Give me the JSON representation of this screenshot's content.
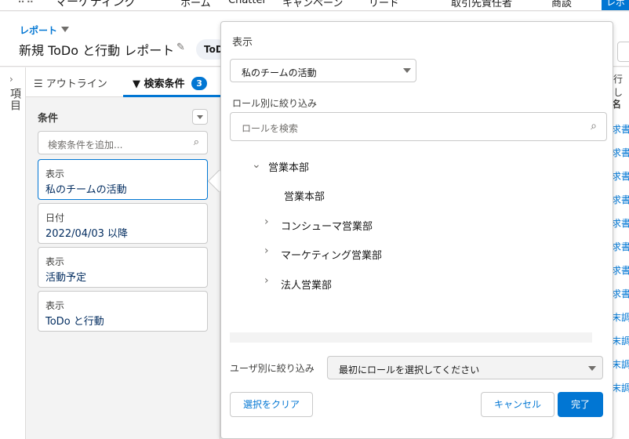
{
  "nav": {
    "app_name": "マーケティング",
    "items": [
      "ホーム",
      "Chatter",
      "キャンペーン",
      "リード",
      "取引先責任者",
      "商談"
    ],
    "active_item": "レポ"
  },
  "header": {
    "breadcrumb": "レポート",
    "title": "新規 ToDo と行動 レポート",
    "pill": "ToD"
  },
  "leftbar": {
    "label": "項目"
  },
  "tabs": {
    "outline": "アウトライン",
    "filters": "検索条件",
    "filters_count": "3"
  },
  "filters": {
    "heading": "条件",
    "search_placeholder": "検索条件を追加...",
    "cards": [
      {
        "key": "表示",
        "value": "私のチームの活動"
      },
      {
        "key": "日付",
        "value": "2022/04/03 以降"
      },
      {
        "key": "表示",
        "value": "活動予定"
      },
      {
        "key": "表示",
        "value": "ToDo と行動"
      }
    ]
  },
  "popover": {
    "show_label": "表示",
    "show_value": "私のチームの活動",
    "role_filter_label": "ロール別に絞り込み",
    "role_search_placeholder": "ロールを検索",
    "tree": {
      "root": "営業本部",
      "root_child": "営業本部",
      "children": [
        "コンシューマ営業部",
        "マーケティング営業部",
        "法人営業部"
      ]
    },
    "user_filter_label": "ユーザ別に絞り込み",
    "user_filter_value": "最初にロールを選択してください",
    "clear_button": "選択をクリア",
    "cancel_button": "キャンセル",
    "done_button": "完了"
  },
  "right_strip": {
    "header": "行し",
    "column": "名",
    "rows": [
      "求書",
      "求書",
      "求書",
      "求書",
      "求書",
      "求書",
      "求書",
      "求書",
      "末調",
      "末調",
      "末調",
      "末調"
    ]
  },
  "colors": {
    "brand": "#0176d3",
    "border": "#c9c9c9"
  },
  "icons": [
    "app-launcher-icon",
    "chevron-down-icon",
    "pencil-icon",
    "list-icon",
    "filter-icon",
    "search-icon",
    "chevron-right-icon"
  ]
}
